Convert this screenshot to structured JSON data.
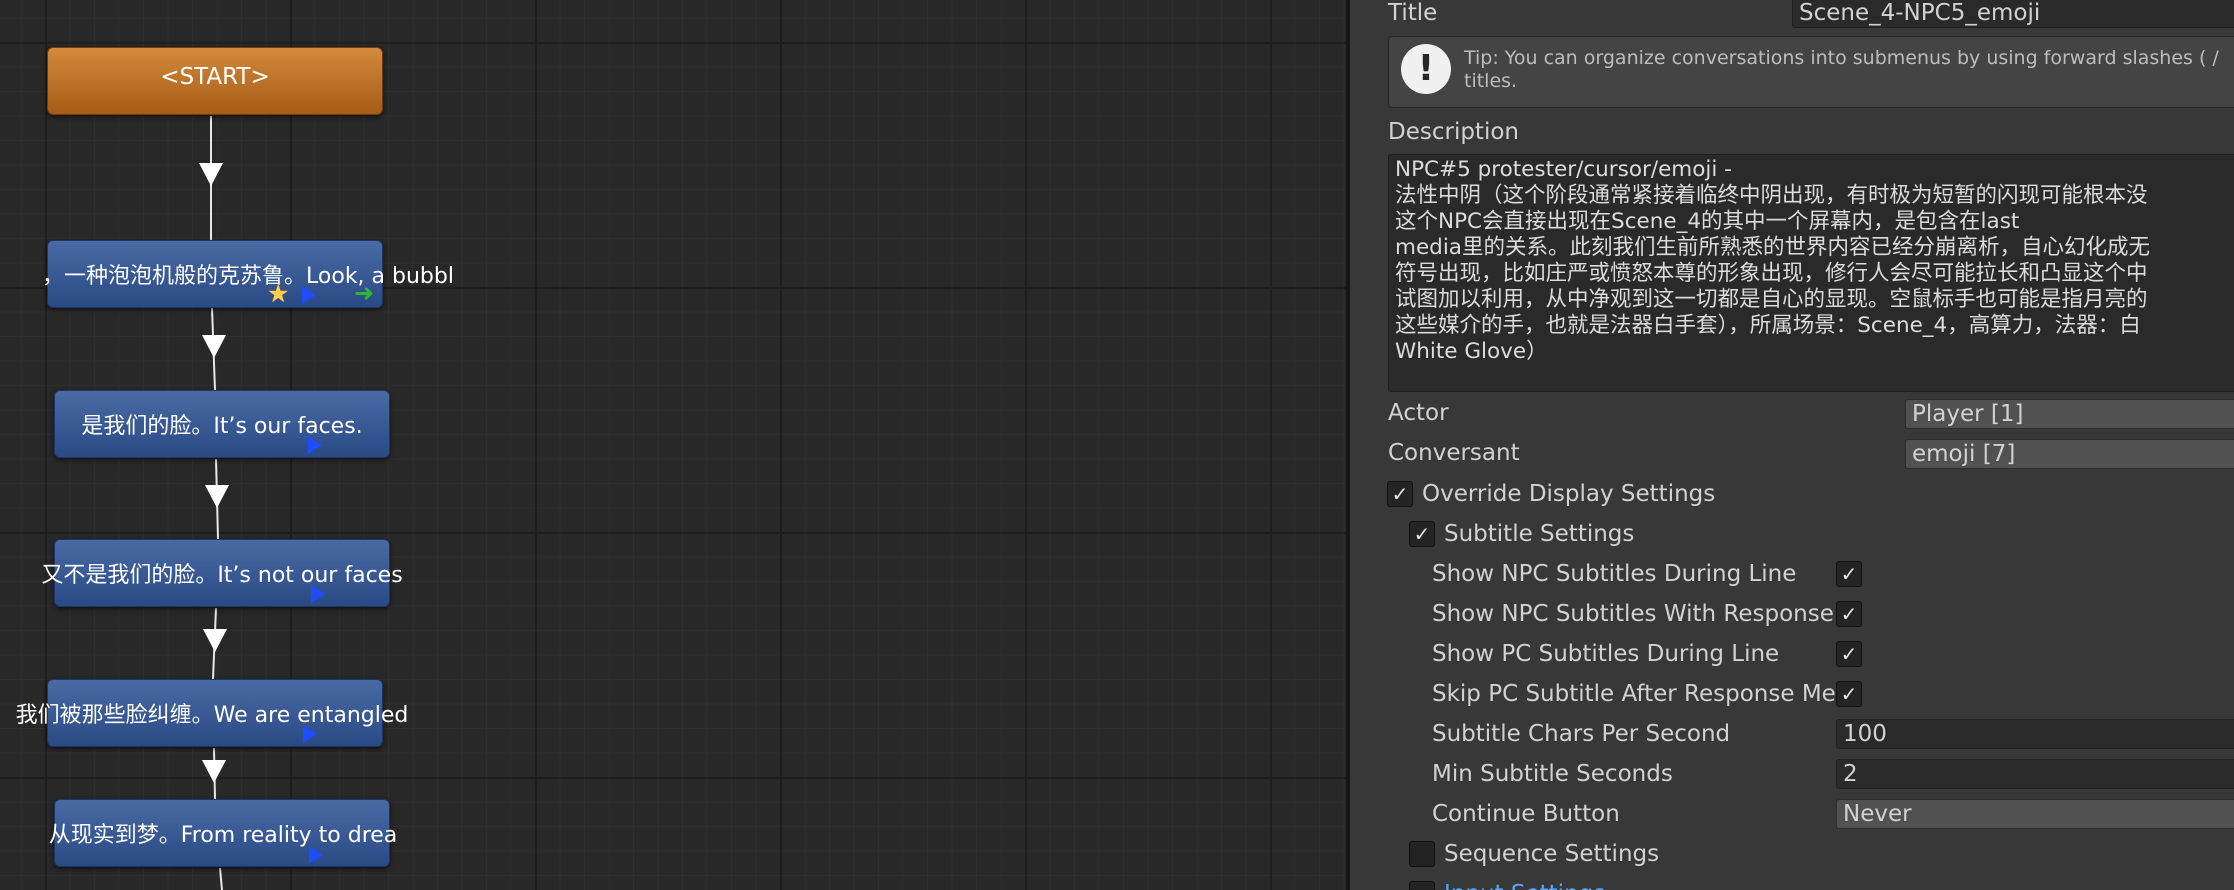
{
  "graph": {
    "start_label": "<START>",
    "nodes": [
      {
        "id": "n1",
        "text": "，一种泡泡机般的克苏鲁。Look, a bubbl"
      },
      {
        "id": "n2",
        "text": "是我们的脸。It’s our faces."
      },
      {
        "id": "n3",
        "text": "又不是我们的脸。It’s not our faces"
      },
      {
        "id": "n4",
        "text": "我们被那些脸纠缠。We are entangled"
      },
      {
        "id": "n5",
        "text": "从现实到梦。From reality to drea"
      }
    ]
  },
  "inspector": {
    "title_label": "Title",
    "title_value": "Scene_4-NPC5_emoji",
    "tip": {
      "icon": "exclamation-icon",
      "line1": "Tip: You can organize conversations into submenus by using forward slashes ( /",
      "line2": "titles."
    },
    "description_label": "Description",
    "description_lines": [
      "NPC#5 protester/cursor/emoji  -",
      "法性中阴（这个阶段通常紧接着临终中阴出现，有时极为短暂的闪现可能根本没",
      "这个NPC会直接出现在Scene_4的其中一个屏幕内，是包含在last",
      "media里的关系。此刻我们生前所熟悉的世界内容已经分崩离析，自心幻化成无",
      "符号出现，比如庄严或愤怒本尊的形象出现，修行人会尽可能拉长和凸显这个中",
      "试图加以利用，从中净观到这一切都是自心的显现。空鼠标手也可能是指月亮的",
      "这些媒介的手，也就是法器白手套），所属场景：Scene_4，高算力，法器：白",
      "White Glove）"
    ],
    "actor_label": "Actor",
    "actor_value": "Player [1]",
    "conversant_label": "Conversant",
    "conversant_value": "emoji [7]",
    "override_label": "Override Display Settings",
    "override_checked": true,
    "subtitle_settings_label": "Subtitle Settings",
    "subtitle_settings_checked": true,
    "rows": [
      {
        "label": "Show NPC Subtitles During Line",
        "checked": true
      },
      {
        "label": "Show NPC Subtitles With Response",
        "checked": true
      },
      {
        "label": "Show PC Subtitles During Line",
        "checked": true
      },
      {
        "label": "Skip PC Subtitle After Response Me",
        "checked": true
      }
    ],
    "chars_per_second_label": "Subtitle Chars Per Second",
    "chars_per_second_value": "100",
    "min_seconds_label": "Min Subtitle Seconds",
    "min_seconds_value": "2",
    "continue_label": "Continue Button",
    "continue_value": "Never",
    "sequence_settings_label": "Sequence Settings",
    "sequence_settings_checked": false,
    "input_settings_label": "Input Settings",
    "input_settings_checked": false
  }
}
